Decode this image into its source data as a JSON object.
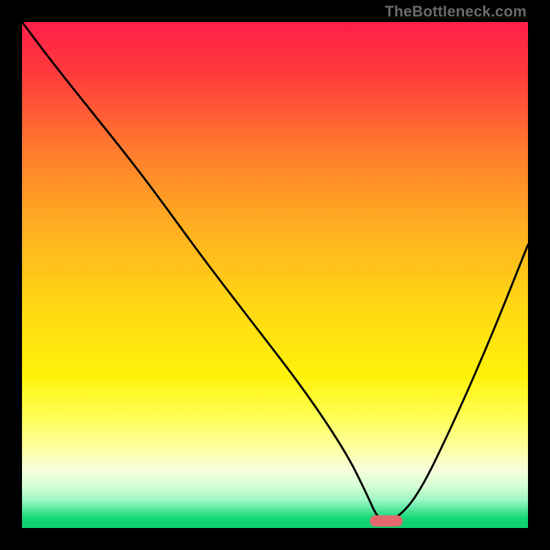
{
  "attribution": "TheBottleneck.com",
  "chart_data": {
    "type": "line",
    "title": "",
    "xlabel": "",
    "ylabel": "",
    "xlim": [
      0,
      100
    ],
    "ylim": [
      0,
      100
    ],
    "background": "rainbow-gradient",
    "gradient_stops": [
      {
        "pos": 0.0,
        "color": "#ff1f49"
      },
      {
        "pos": 0.1,
        "color": "#ff3a3c"
      },
      {
        "pos": 0.25,
        "color": "#ff7a2e"
      },
      {
        "pos": 0.4,
        "color": "#ffad21"
      },
      {
        "pos": 0.55,
        "color": "#ffd514"
      },
      {
        "pos": 0.7,
        "color": "#fff20a"
      },
      {
        "pos": 0.78,
        "color": "#ffff55"
      },
      {
        "pos": 0.84,
        "color": "#fdff9e"
      },
      {
        "pos": 0.885,
        "color": "#f6ffdb"
      },
      {
        "pos": 0.915,
        "color": "#d9ffd6"
      },
      {
        "pos": 0.945,
        "color": "#9cf7c2"
      },
      {
        "pos": 0.965,
        "color": "#4ee79a"
      },
      {
        "pos": 0.98,
        "color": "#15d877"
      },
      {
        "pos": 1.0,
        "color": "#0fd072"
      }
    ],
    "series": [
      {
        "name": "bottleneck-curve",
        "color": "#000000",
        "x": [
          0,
          6,
          14,
          22,
          28,
          36,
          46,
          56,
          64,
          68,
          70.5,
          73.5,
          78,
          84,
          92,
          100
        ],
        "y": [
          100,
          92,
          82,
          72,
          64,
          53,
          40,
          27,
          15,
          7,
          1.4,
          1.4,
          6,
          18,
          36,
          56
        ]
      }
    ],
    "marker": {
      "name": "optimal-range",
      "x": 72,
      "y": 1.4,
      "w": 6.5,
      "h": 2.2,
      "color": "#e4686d",
      "rx": 1.1
    }
  }
}
